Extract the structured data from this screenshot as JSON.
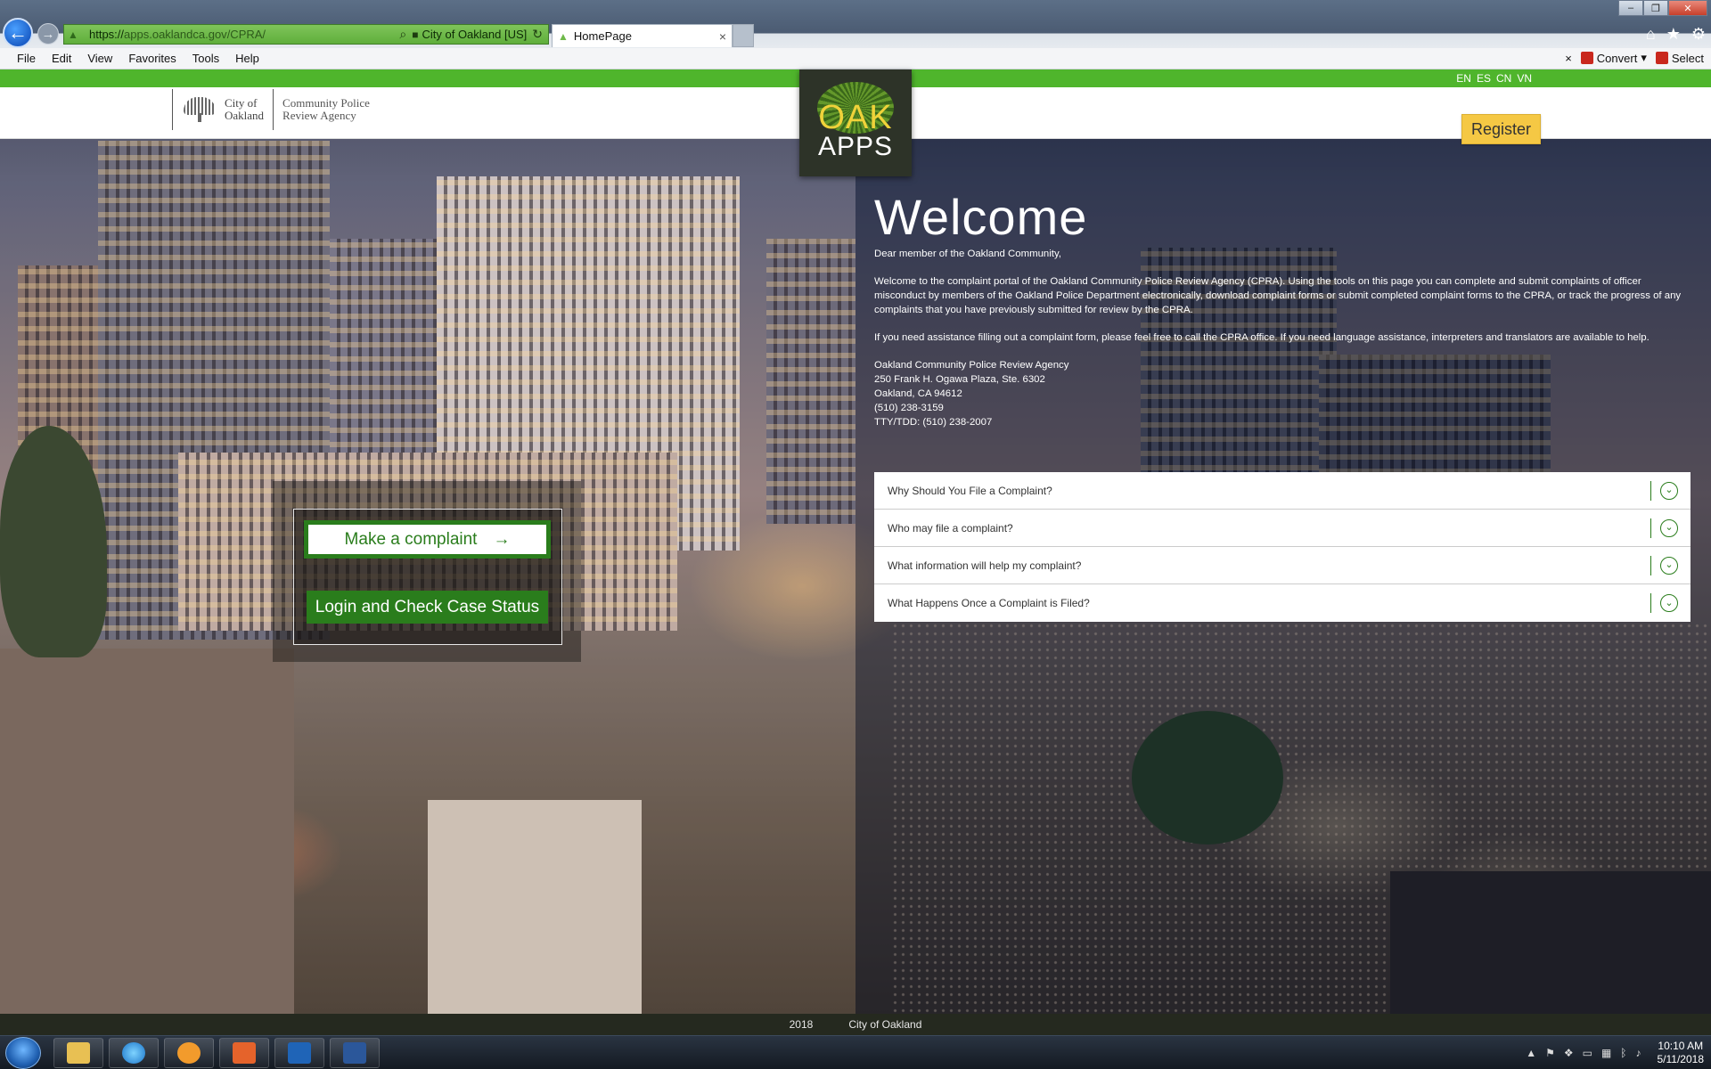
{
  "browser": {
    "url_prefix": "https://",
    "url_host": "apps.oaklandca.gov",
    "url_path": "/CPRA/",
    "cert_label": "City of Oakland [US]",
    "tab_title": "HomePage",
    "menu": [
      "File",
      "Edit",
      "View",
      "Favorites",
      "Tools",
      "Help"
    ],
    "convert_label": "Convert",
    "select_label": "Select",
    "close_glyph": "×"
  },
  "header": {
    "languages": [
      "EN",
      "ES",
      "CN",
      "VN"
    ],
    "city_name_line1": "City of",
    "city_name_line2": "Oakland",
    "agency_line1": "Community Police",
    "agency_line2": "Review Agency",
    "badge_line1": "OAK",
    "badge_line2": "APPS",
    "register_label": "Register"
  },
  "actions": {
    "make_complaint_label": "Make a complaint",
    "make_complaint_arrow": "→",
    "login_label": "Login and Check Case Status"
  },
  "welcome": {
    "title": "Welcome",
    "greeting": "Dear member of the Oakland Community,",
    "paragraph1": "Welcome to the complaint portal of the Oakland Community Police Review Agency (CPRA).  Using the tools on this page you can complete and submit complaints of officer misconduct by members of the Oakland Police Department electronically, download complaint forms or submit completed complaint forms to the CPRA, or track the progress of any complaints that you have previously submitted for review by the CPRA.",
    "paragraph2": "If you need assistance filling out a complaint form, please feel free to call the CPRA office.  If you need language assistance, interpreters and translators are available to help.",
    "address": {
      "name": "Oakland Community Police Review Agency",
      "street": "250 Frank H. Ogawa Plaza, Ste. 6302",
      "city": "Oakland, CA 94612",
      "phone": "(510) 238-3159",
      "tty": "TTY/TDD: (510) 238-2007"
    }
  },
  "faq": [
    {
      "question": "Why Should You File a Complaint?"
    },
    {
      "question": "Who may file a complaint?"
    },
    {
      "question": "What information will help my complaint?"
    },
    {
      "question": "What Happens Once a Complaint is Filed?"
    }
  ],
  "footer": {
    "year": "2018",
    "org": "City of Oakland"
  },
  "taskbar": {
    "time": "10:10 AM",
    "date": "5/11/2018"
  },
  "colors": {
    "brand_green": "#2a7d1c",
    "strip_green": "#4fb52c",
    "register_yellow": "#f5c844",
    "badge_yellow": "#f0d23a"
  }
}
